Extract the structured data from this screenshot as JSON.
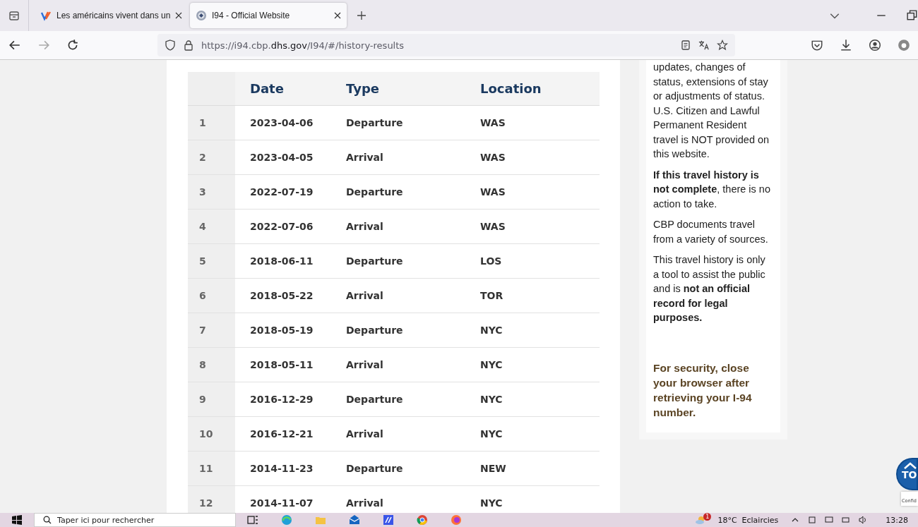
{
  "browser": {
    "tabs": [
      {
        "title": "Les américains vivent dans un",
        "selected": false,
        "kind": "jv"
      },
      {
        "title": "I94 - Official Website",
        "selected": true,
        "kind": "seal"
      }
    ],
    "url": {
      "before": "https://i94.cbp.",
      "domain": "dhs.gov",
      "after": "/I94/#/history-results"
    }
  },
  "table": {
    "columns": [
      "Date",
      "Type",
      "Location"
    ],
    "rows": [
      {
        "number": "1",
        "date": "2023-04-06",
        "type": "Departure",
        "location": "WAS"
      },
      {
        "number": "2",
        "date": "2023-04-05",
        "type": "Arrival",
        "location": "WAS"
      },
      {
        "number": "3",
        "date": "2022-07-19",
        "type": "Departure",
        "location": "WAS"
      },
      {
        "number": "4",
        "date": "2022-07-06",
        "type": "Arrival",
        "location": "WAS"
      },
      {
        "number": "5",
        "date": "2018-06-11",
        "type": "Departure",
        "location": "LOS"
      },
      {
        "number": "6",
        "date": "2018-05-22",
        "type": "Arrival",
        "location": "TOR"
      },
      {
        "number": "7",
        "date": "2018-05-19",
        "type": "Departure",
        "location": "NYC"
      },
      {
        "number": "8",
        "date": "2018-05-11",
        "type": "Arrival",
        "location": "NYC"
      },
      {
        "number": "9",
        "date": "2016-12-29",
        "type": "Departure",
        "location": "NYC"
      },
      {
        "number": "10",
        "date": "2016-12-21",
        "type": "Arrival",
        "location": "NYC"
      },
      {
        "number": "11",
        "date": "2014-11-23",
        "type": "Departure",
        "location": "NEW"
      },
      {
        "number": "12",
        "date": "2014-11-07",
        "type": "Arrival",
        "location": "NYC"
      }
    ]
  },
  "sidebar": {
    "paragraphs": [
      "updates, changes of status, extensions of stay or adjustments of status. U.S. Citizen and Lawful Permanent Resident travel is NOT provided on this website.",
      "**If this travel history is not complete**, there is no action to take.",
      "CBP documents travel from a variety of sources.",
      "This travel history is only a tool to assist the public and is **not an official record for legal purposes.**"
    ],
    "security_note": "For security, close your browser after retrieving your I-94 number."
  },
  "scroll_top": {
    "label": "TO"
  },
  "recaptcha": {
    "label": "Confid"
  },
  "taskbar": {
    "search_placeholder": "Taper ici pour rechercher",
    "weather_badge": "1",
    "weather": "18°C  Eclaircies",
    "clock": "13:28"
  }
}
